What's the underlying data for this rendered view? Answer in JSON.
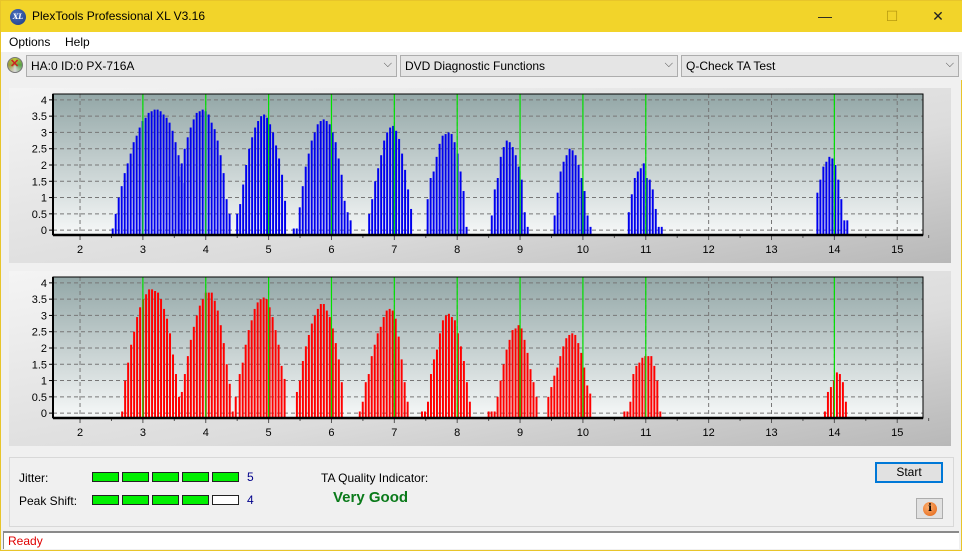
{
  "window": {
    "title": "PlexTools Professional XL V3.16",
    "logo_text": "XL",
    "minimize_glyph": "—",
    "maximize_glyph": "☐",
    "close_glyph": "✕"
  },
  "menu": {
    "items": [
      {
        "label": "Options"
      },
      {
        "label": "Help"
      }
    ]
  },
  "toolbar": {
    "drive_icon": "disc-drive-icon",
    "drive_select": "HA:0 ID:0  PX-716A",
    "function_select": "DVD Diagnostic Functions",
    "test_select": "Q-Check TA Test",
    "chevron": "⌵"
  },
  "chart_data": [
    {
      "type": "bar",
      "name": "ta-histogram-land",
      "color": "#0000ee",
      "marker_color": "#00e000",
      "xlim": [
        1.57,
        15.41
      ],
      "ylim": [
        -0.15,
        4.18
      ],
      "xticks": [
        2,
        3,
        4,
        5,
        6,
        7,
        8,
        9,
        10,
        11,
        12,
        13,
        14,
        15
      ],
      "yticks": [
        0,
        0.5,
        1,
        1.5,
        2,
        2.5,
        3,
        3.5,
        4
      ],
      "ytick_labels": [
        "0",
        "0.5",
        "1",
        "1.5",
        "2",
        "2.5",
        "3",
        "3.5",
        "4"
      ],
      "reference_lines": [
        3,
        4,
        5,
        6,
        7,
        8,
        9,
        10,
        11,
        14
      ],
      "grid": true,
      "bar_step": 0.0476,
      "peaks": [
        {
          "start": 2.52,
          "values": [
            0.05,
            0.5,
            1.0,
            1.35,
            1.75,
            2.05,
            2.35,
            2.7,
            2.9,
            3.15,
            3.35,
            3.45,
            3.6,
            3.65,
            3.7,
            3.7,
            3.65,
            3.55,
            3.45,
            3.3,
            3.05,
            2.7,
            2.3,
            1.95,
            1.45
          ]
        },
        {
          "start": 3.57,
          "values": [
            1.65,
            2.05,
            2.5,
            2.85,
            3.15,
            3.4,
            3.6,
            3.65,
            3.7,
            3.65,
            3.55,
            3.3,
            3.1,
            2.75,
            2.3,
            1.75,
            0.95,
            0.5
          ]
        },
        {
          "start": 4.5,
          "values": [
            0.5,
            0.8,
            1.4,
            2.0,
            2.5,
            2.85,
            3.15,
            3.35,
            3.5,
            3.55,
            3.45,
            3.25,
            3.0,
            2.6,
            2.2,
            1.7,
            0.9
          ]
        },
        {
          "start": 5.4,
          "values": [
            0.05,
            0.05,
            0.7,
            1.35,
            1.95,
            2.35,
            2.75,
            3.0,
            3.25,
            3.35,
            3.4,
            3.35,
            3.25,
            3.0,
            2.7,
            2.2,
            1.7,
            0.9,
            0.55,
            0.3
          ]
        },
        {
          "start": 6.6,
          "values": [
            0.5,
            0.95,
            1.5,
            1.9,
            2.3,
            2.75,
            3.0,
            3.15,
            3.2,
            3.05,
            2.8,
            2.35,
            1.85,
            1.25,
            0.65
          ]
        },
        {
          "start": 7.53,
          "values": [
            0.95,
            1.6,
            1.8,
            2.25,
            2.65,
            2.9,
            2.95,
            3.0,
            2.95,
            2.7,
            2.35,
            1.8,
            1.2,
            0.1
          ]
        },
        {
          "start": 8.55,
          "values": [
            0.45,
            1.25,
            1.6,
            2.25,
            2.55,
            2.75,
            2.7,
            2.55,
            2.3,
            1.95,
            1.55,
            0.55,
            0.1
          ]
        },
        {
          "start": 9.55,
          "values": [
            0.45,
            1.15,
            1.8,
            2.1,
            2.3,
            2.5,
            2.45,
            2.3,
            2.0,
            1.6,
            1.2,
            0.45,
            0.1
          ]
        },
        {
          "start": 10.73,
          "values": [
            0.55,
            1.1,
            1.6,
            1.8,
            1.9,
            2.05,
            1.6,
            1.55,
            1.25,
            0.65,
            0.1,
            0.1
          ]
        },
        {
          "start": 13.73,
          "values": [
            1.15,
            1.55,
            1.95,
            2.1,
            2.25,
            2.2,
            2.0,
            1.55,
            0.95,
            0.3,
            0.3
          ]
        }
      ]
    },
    {
      "type": "bar",
      "name": "ta-histogram-groove",
      "color": "#ff0000",
      "marker_color": "#00e000",
      "xlim": [
        1.57,
        15.41
      ],
      "ylim": [
        -0.15,
        4.18
      ],
      "xticks": [
        2,
        3,
        4,
        5,
        6,
        7,
        8,
        9,
        10,
        11,
        12,
        13,
        14,
        15
      ],
      "yticks": [
        0,
        0.5,
        1,
        1.5,
        2,
        2.5,
        3,
        3.5,
        4
      ],
      "ytick_labels": [
        "0",
        "0.5",
        "1",
        "1.5",
        "2",
        "2.5",
        "3",
        "3.5",
        "4"
      ],
      "reference_lines": [
        3,
        4,
        5,
        6,
        7,
        8,
        9,
        10,
        11,
        14
      ],
      "grid": true,
      "bar_step": 0.0476,
      "peaks": [
        {
          "start": 2.67,
          "values": [
            0.05,
            1.0,
            1.55,
            2.1,
            2.5,
            2.95,
            3.25,
            3.5,
            3.65,
            3.8,
            3.8,
            3.75,
            3.7,
            3.5,
            3.2,
            2.9,
            2.45,
            1.8,
            1.2,
            0.5
          ]
        },
        {
          "start": 3.62,
          "values": [
            0.65,
            1.2,
            1.75,
            2.25,
            2.65,
            3.0,
            3.3,
            3.5,
            3.7,
            3.7,
            3.7,
            3.45,
            3.15,
            2.7,
            2.15,
            1.5,
            0.9,
            0.05,
            0.5
          ]
        },
        {
          "start": 4.54,
          "values": [
            1.2,
            1.55,
            2.1,
            2.55,
            2.85,
            3.2,
            3.4,
            3.5,
            3.55,
            3.5,
            3.25,
            2.95,
            2.55,
            2.1,
            1.45,
            1.05
          ]
        },
        {
          "start": 5.45,
          "values": [
            0.65,
            1.0,
            1.6,
            2.05,
            2.4,
            2.75,
            3.0,
            3.2,
            3.35,
            3.35,
            3.15,
            2.95,
            2.6,
            2.15,
            1.65,
            0.95
          ]
        },
        {
          "start": 6.45,
          "values": [
            0.05,
            0.35,
            0.95,
            1.2,
            1.75,
            2.1,
            2.45,
            2.65,
            2.95,
            3.15,
            3.2,
            3.15,
            2.9,
            2.35,
            1.65,
            0.95,
            0.35
          ]
        },
        {
          "start": 7.44,
          "values": [
            0.05,
            0.05,
            0.35,
            1.2,
            1.65,
            1.95,
            2.45,
            2.85,
            3.0,
            3.05,
            2.95,
            2.85,
            2.45,
            2.05,
            1.6,
            0.95,
            0.35
          ]
        },
        {
          "start": 8.5,
          "values": [
            0.05,
            0.05,
            0.05,
            0.5,
            1.0,
            1.5,
            1.95,
            2.25,
            2.55,
            2.6,
            2.7,
            2.6,
            2.25,
            1.85,
            1.35,
            0.95,
            0.5
          ]
        },
        {
          "start": 9.45,
          "values": [
            0.5,
            0.8,
            1.15,
            1.4,
            1.75,
            2.05,
            2.3,
            2.4,
            2.45,
            2.4,
            2.15,
            1.85,
            1.4,
            0.85,
            0.6
          ]
        },
        {
          "start": 10.66,
          "values": [
            0.05,
            0.05,
            0.35,
            1.2,
            1.45,
            1.55,
            1.7,
            1.75,
            1.75,
            1.75,
            1.45,
            1.0,
            0.05
          ]
        },
        {
          "start": 13.85,
          "values": [
            0.05,
            0.65,
            0.8,
            1.0,
            1.25,
            1.2,
            0.95,
            0.35
          ]
        }
      ]
    }
  ],
  "results": {
    "jitter_label": "Jitter:",
    "jitter_value": 5,
    "jitter_display": "5",
    "peak_shift_label": "Peak Shift:",
    "peak_shift_value": 4,
    "peak_shift_display": "4",
    "meter_max": 5,
    "ta_quality_label": "TA Quality Indicator:",
    "ta_quality_value": "Very Good",
    "start_label": "Start",
    "info_glyph": "i"
  },
  "status": {
    "text": "Ready"
  }
}
